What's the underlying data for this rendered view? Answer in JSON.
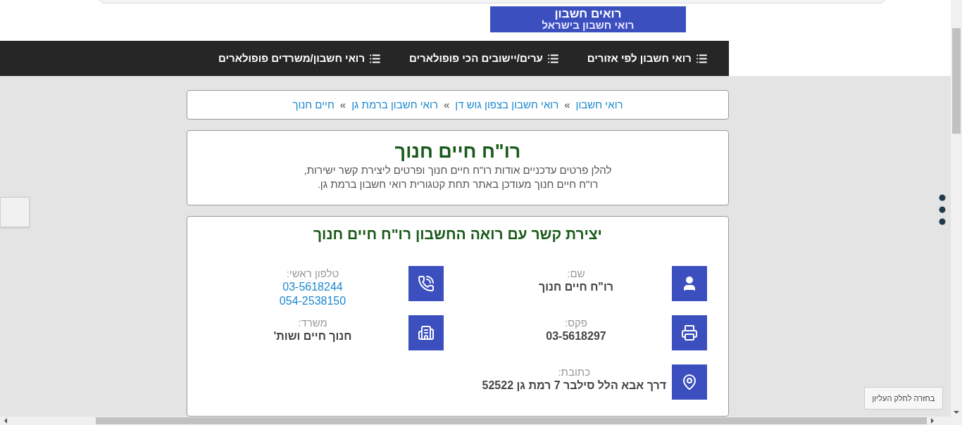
{
  "logo": {
    "title": "רואים חשבון",
    "subtitle": "רואי חשבון בישראל"
  },
  "nav": [
    {
      "label": "רואי חשבון לפי אזורים"
    },
    {
      "label": "ערים/יישובים הכי פופולארים"
    },
    {
      "label": "רואי חשבון/משרדים פופולארים"
    }
  ],
  "breadcrumb": [
    {
      "label": "רואי חשבון"
    },
    {
      "label": "רואי חשבון בצפון גוש דן"
    },
    {
      "label": "רואי חשבון ברמת גן"
    },
    {
      "label": "חיים חנוך"
    }
  ],
  "breadcrumb_separator": "»",
  "intro": {
    "title": "רו\"ח חיים חנוך",
    "lines": [
      "להלן פרטים עדכניים אודות רו\"ח חיים חנוך ופרטים ליצירת קשר ישירות,",
      "רו\"ח חיים חנוך מעודכן באתר תחת קטגורית רואי חשבון ברמת גן."
    ]
  },
  "contact": {
    "title": "יצירת קשר עם רואה החשבון רו\"ח חיים חנוך",
    "items": [
      {
        "kind": "person",
        "label": "שם:",
        "values": [
          "רו\"ח חיים חנוך"
        ],
        "link": false
      },
      {
        "kind": "phone",
        "label": "טלפון ראשי:",
        "values": [
          "03-5618244",
          "054-2538150"
        ],
        "link": true
      },
      {
        "kind": "fax",
        "label": "פקס:",
        "values": [
          "03-5618297"
        ],
        "link": false
      },
      {
        "kind": "office",
        "label": "משרד:",
        "values": [
          "חנוך חיים ושות'"
        ],
        "link": false
      },
      {
        "kind": "address",
        "label": "כתובת:",
        "values": [
          "דרך אבא הלל סילבר 7 רמת גן 52522"
        ],
        "link": false
      }
    ]
  },
  "back_to_top": "בחזרה לחלק העליון"
}
